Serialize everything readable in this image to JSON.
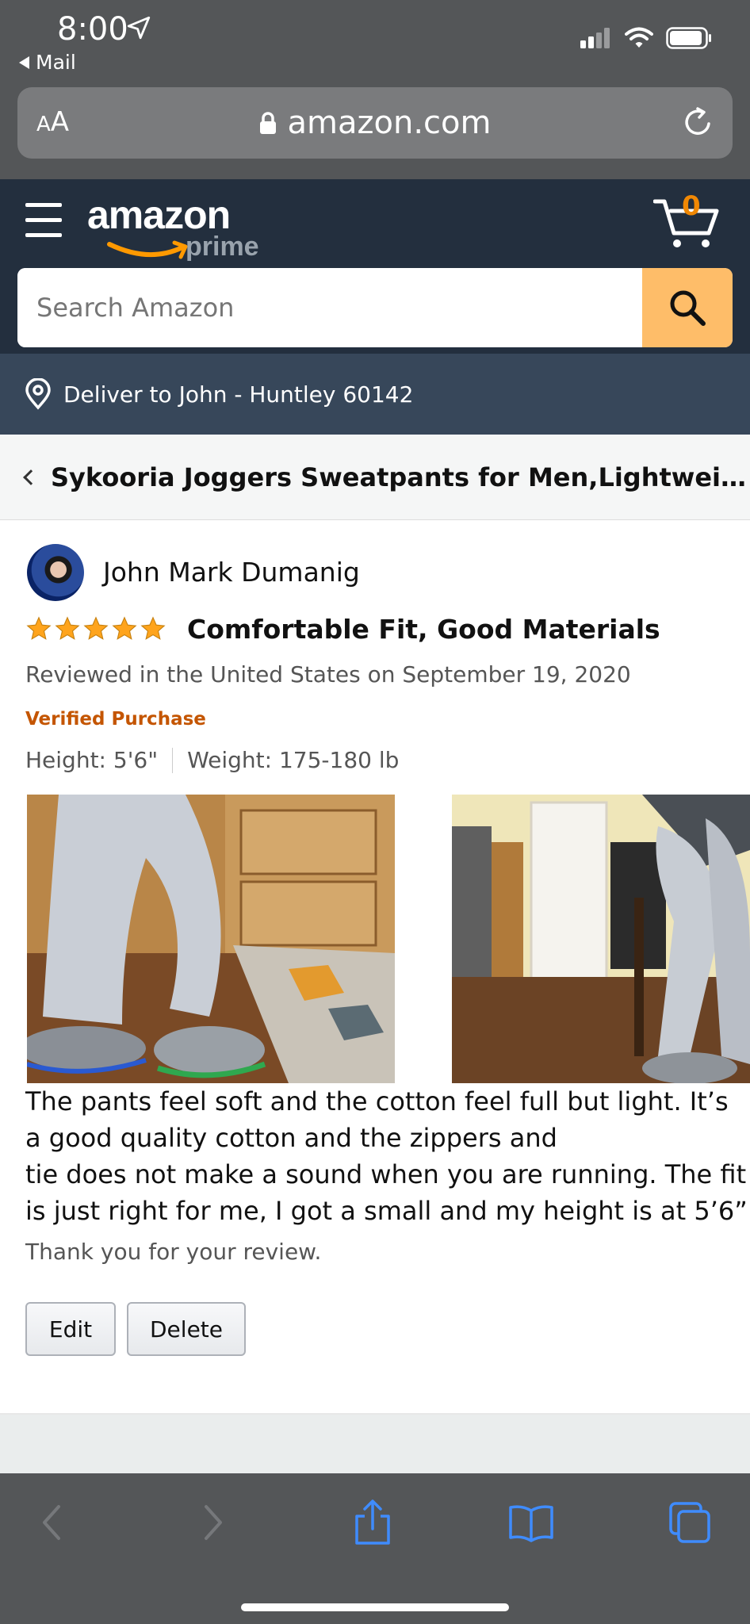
{
  "status": {
    "time": "8:00",
    "back_app": "Mail"
  },
  "browser": {
    "text_size_label_small": "A",
    "text_size_label_large": "A",
    "host": "amazon.com"
  },
  "header": {
    "logo_word": "amazon",
    "logo_sub": "prime",
    "cart_count": "0",
    "search_placeholder": "Search Amazon",
    "deliver_to": "Deliver to John - Huntley 60142"
  },
  "breadcrumb": {
    "product_title": "Sykooria Joggers Sweatpants for Men,Lightweight..."
  },
  "review": {
    "author": "John Mark Dumanig",
    "rating": 5,
    "rating_max": 5,
    "title": "Comfortable Fit, Good Materials",
    "meta": "Reviewed in the United States on September 19, 2020",
    "verified": "Verified Purchase",
    "height": "Height: 5'6\"",
    "weight": "Weight: 175-180 lb",
    "body_lines": [
      "The pants feel soft and the cotton feel full but light. It’s",
      "a good quality cotton and the zippers and",
      "tie does not make a sound when you are running. The fit",
      "is just right for me, I got a small and my height is at 5’6”."
    ],
    "thanks": "Thank you for your review.",
    "edit_label": "Edit",
    "delete_label": "Delete"
  },
  "colors": {
    "header_bg": "#232f3e",
    "deliver_bg": "#37475a",
    "search_button": "#febd69",
    "star": "#ffa41c",
    "verified": "#c45500",
    "cart_count": "#f08804",
    "toolbar_active": "#3f8cff"
  },
  "toolbar": {
    "icons": [
      "chevron-left-icon",
      "chevron-right-icon",
      "share-icon",
      "bookmarks-icon",
      "tabs-icon"
    ]
  }
}
